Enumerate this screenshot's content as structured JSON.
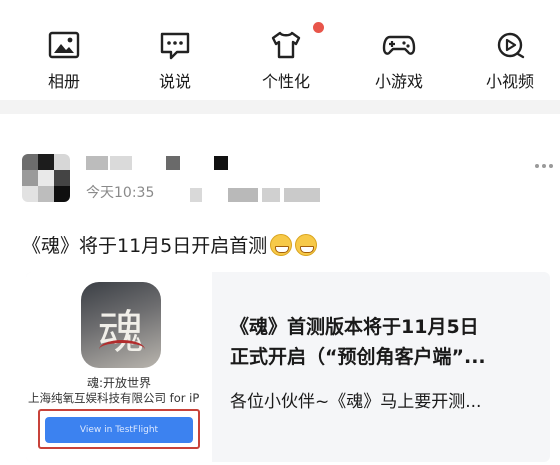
{
  "shortcuts": {
    "album": {
      "label": "相册",
      "icon": "image-icon"
    },
    "moments": {
      "label": "说说",
      "icon": "chat-bubble-icon"
    },
    "personalize": {
      "label": "个性化",
      "icon": "tshirt-icon"
    },
    "games": {
      "label": "小游戏",
      "icon": "gamepad-icon"
    },
    "videos": {
      "label": "小视频",
      "icon": "play-circle-icon"
    }
  },
  "post": {
    "time": "今天10:35",
    "text": "《魂》将于11月5日开启首测",
    "emoji": "grinning-face",
    "link_card": {
      "thumb_title": "魂:开放世界",
      "thumb_publisher": "上海纯氧互娱科技有限公司 for iP",
      "thumb_button": "View in TestFlight",
      "title_line1": "《魂》首测版本将于11月5日",
      "title_line2": "正式开启（“预创角客户端”...",
      "description": "各位小伙伴~《魂》马上要开测...",
      "app_glyph": "魂"
    }
  },
  "colors": {
    "notification_dot": "#e8554a",
    "testflight_button": "#3c82f0",
    "highlight_frame": "#c8423a"
  }
}
